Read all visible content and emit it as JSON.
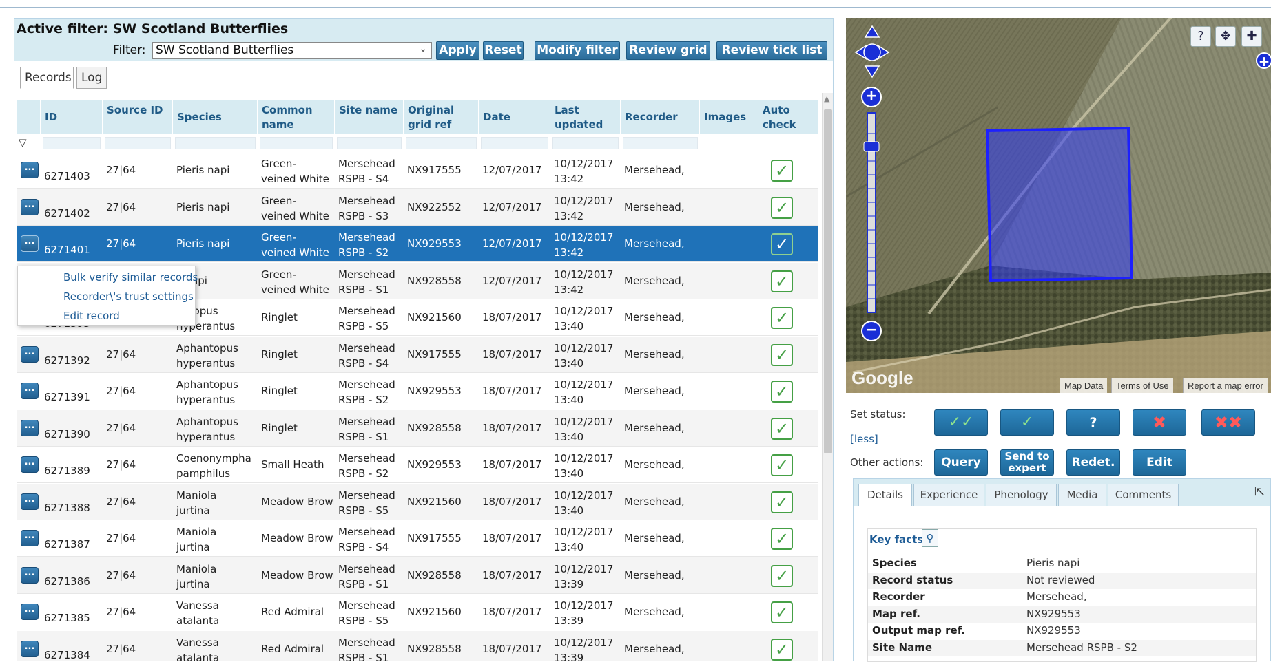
{
  "filter": {
    "title": "Active filter: SW Scotland Butterflies",
    "label": "Filter:",
    "selected": "SW Scotland Butterflies",
    "buttons": [
      "Apply",
      "Reset",
      "Modify filter",
      "Review grid",
      "Review tick list"
    ]
  },
  "tabs": [
    "Records",
    "Log"
  ],
  "grid": {
    "columns": [
      "ID",
      "Source ID",
      "Species",
      "Common name",
      "Site name",
      "Original grid ref",
      "Date",
      "Last updated",
      "Recorder",
      "Images",
      "Auto check"
    ],
    "rows": [
      {
        "id": "6271403",
        "source": "27|64",
        "species": "Pieris napi",
        "common": "Green-veined White",
        "site": "Mersehead RSPB - S4",
        "grid": "NX917555",
        "date": "12/07/2017",
        "updated": "10/12/2017 13:42",
        "recorder": "Mersehead,"
      },
      {
        "id": "6271402",
        "source": "27|64",
        "species": "Pieris napi",
        "common": "Green-veined White",
        "site": "Mersehead RSPB - S3",
        "grid": "NX922552",
        "date": "12/07/2017",
        "updated": "10/12/2017 13:42",
        "recorder": "Mersehead,"
      },
      {
        "id": "6271401",
        "source": "27|64",
        "species": "Pieris napi",
        "common": "Green-veined White",
        "site": "Mersehead RSPB - S2",
        "grid": "NX929553",
        "date": "12/07/2017",
        "updated": "10/12/2017 13:42",
        "recorder": "Mersehead,"
      },
      {
        "id": "",
        "source": "",
        "species": "s napi",
        "common": "Green-veined White",
        "site": "Mersehead RSPB - S1",
        "grid": "NX928558",
        "date": "12/07/2017",
        "updated": "10/12/2017 13:42",
        "recorder": "Mersehead,"
      },
      {
        "id": "6271393",
        "source": "",
        "species": "antopus hyperantus",
        "common": "Ringlet",
        "site": "Mersehead RSPB - S5",
        "grid": "NX921560",
        "date": "18/07/2017",
        "updated": "10/12/2017 13:40",
        "recorder": "Mersehead,"
      },
      {
        "id": "6271392",
        "source": "27|64",
        "species": "Aphantopus hyperantus",
        "common": "Ringlet",
        "site": "Mersehead RSPB - S4",
        "grid": "NX917555",
        "date": "18/07/2017",
        "updated": "10/12/2017 13:40",
        "recorder": "Mersehead,"
      },
      {
        "id": "6271391",
        "source": "27|64",
        "species": "Aphantopus hyperantus",
        "common": "Ringlet",
        "site": "Mersehead RSPB - S2",
        "grid": "NX929553",
        "date": "18/07/2017",
        "updated": "10/12/2017 13:40",
        "recorder": "Mersehead,"
      },
      {
        "id": "6271390",
        "source": "27|64",
        "species": "Aphantopus hyperantus",
        "common": "Ringlet",
        "site": "Mersehead RSPB - S1",
        "grid": "NX928558",
        "date": "18/07/2017",
        "updated": "10/12/2017 13:40",
        "recorder": "Mersehead,"
      },
      {
        "id": "6271389",
        "source": "27|64",
        "species": "Coenonympha pamphilus",
        "common": "Small Heath",
        "site": "Mersehead RSPB - S2",
        "grid": "NX929553",
        "date": "18/07/2017",
        "updated": "10/12/2017 13:40",
        "recorder": "Mersehead,"
      },
      {
        "id": "6271388",
        "source": "27|64",
        "species": "Maniola jurtina",
        "common": "Meadow Brown",
        "site": "Mersehead RSPB - S5",
        "grid": "NX921560",
        "date": "18/07/2017",
        "updated": "10/12/2017 13:40",
        "recorder": "Mersehead,"
      },
      {
        "id": "6271387",
        "source": "27|64",
        "species": "Maniola jurtina",
        "common": "Meadow Brown",
        "site": "Mersehead RSPB - S4",
        "grid": "NX917555",
        "date": "18/07/2017",
        "updated": "10/12/2017 13:40",
        "recorder": "Mersehead,"
      },
      {
        "id": "6271386",
        "source": "27|64",
        "species": "Maniola jurtina",
        "common": "Meadow Brown",
        "site": "Mersehead RSPB - S1",
        "grid": "NX928558",
        "date": "18/07/2017",
        "updated": "10/12/2017 13:39",
        "recorder": "Mersehead,"
      },
      {
        "id": "6271385",
        "source": "27|64",
        "species": "Vanessa atalanta",
        "common": "Red Admiral",
        "site": "Mersehead RSPB - S5",
        "grid": "NX921560",
        "date": "18/07/2017",
        "updated": "10/12/2017 13:39",
        "recorder": "Mersehead,"
      },
      {
        "id": "6271384",
        "source": "27|64",
        "species": "Vanessa atalanta",
        "common": "Red Admiral",
        "site": "Mersehead RSPB - S1",
        "grid": "NX928558",
        "date": "18/07/2017",
        "updated": "10/12/2017 13:39",
        "recorder": "Mersehead,"
      }
    ],
    "row_button_label": "...",
    "filter_icon": "funnel-icon",
    "check_icon": "checkmark-icon"
  },
  "context_menu": [
    "Bulk verify similar records",
    "Recorder\\'s trust settings",
    "Edit record"
  ],
  "map": {
    "attribution": [
      "Map Data",
      "Terms of Use",
      "Report a map error"
    ],
    "brand": "Google",
    "icons": [
      "help-icon",
      "pan-icon",
      "move-icon",
      "zoom-in-icon",
      "zoom-out-icon"
    ]
  },
  "status": {
    "set_label": "Set status:",
    "less_link": "[less]",
    "other_label": "Other actions:",
    "actions": [
      "Query",
      "Send to expert",
      "Redet.",
      "Edit"
    ]
  },
  "details": {
    "tabs": [
      "Details",
      "Experience",
      "Phenology",
      "Media",
      "Comments"
    ],
    "key_facts_title": "Key facts",
    "facts": [
      {
        "k": "Species",
        "v": "Pieris napi"
      },
      {
        "k": "Record status",
        "v": "Not reviewed"
      },
      {
        "k": "Recorder",
        "v": "Mersehead,"
      },
      {
        "k": "Map ref.",
        "v": "NX929553"
      },
      {
        "k": "Output map ref.",
        "v": "NX929553"
      },
      {
        "k": "Site Name",
        "v": "Mersehead RSPB - S2"
      }
    ]
  },
  "colors": {
    "accent": "#1f72b8",
    "header_bg": "#d7ebf2",
    "header_text": "#1f5a86",
    "check_green": "#45a045",
    "reject_red": "#ff5a5a"
  }
}
